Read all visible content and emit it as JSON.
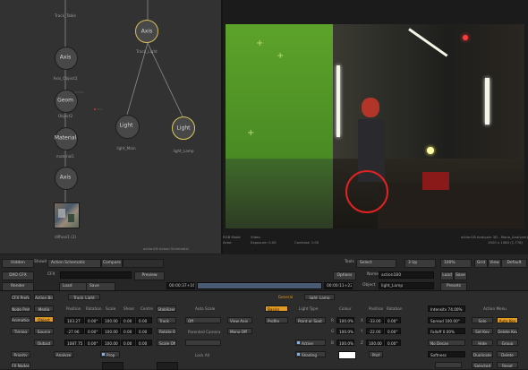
{
  "schematic": {
    "nodes": {
      "axis1": {
        "label": "Axis",
        "sublabel": "Axis_Object2"
      },
      "geom": {
        "label": "Geom",
        "sublabel": "Object2"
      },
      "material": {
        "label": "Material",
        "sublabel": "material1"
      },
      "axis2": {
        "label": "Axis"
      },
      "diffuse": {
        "sublabel": "diffuse1 (2)"
      },
      "axis_top": {
        "label": "Axis",
        "sublabel": "Track_Light"
      },
      "light_main": {
        "label": "Light",
        "sublabel": "light_Main"
      },
      "light_lamp": {
        "label": "Light",
        "sublabel": "light_Lamp"
      },
      "track_table": {
        "sublabel": "Track_Table"
      }
    },
    "footer": "action1B Action Schematic"
  },
  "viewer": {
    "info_left": [
      "RGB Mode",
      "Actor"
    ],
    "info_mid": [
      "Video",
      "Exposure: 0.00"
    ],
    "info_mid2": "Contrast: 1.00",
    "info_right": [
      "action1B Analyzer 3D - Mono_Analyzer)",
      "1920 x 1080 (1.778)"
    ]
  },
  "toolbar": {
    "hidden": "Hidden",
    "showing_label": "Showing",
    "showing_value": "Action Schematic",
    "compare": "Compare",
    "tools_label": "Tools",
    "tools_value": "Select",
    "view_value": "3 Up",
    "zoom": "100%",
    "grid": "Grid",
    "view": "View",
    "default": "Default",
    "dxo": "DXO CFX",
    "cfx": "CFX",
    "preview": "Preview",
    "options": "Options",
    "name_label": "Name",
    "name_value": "action1B0",
    "load_top": "Load",
    "save_top": "Save",
    "render": "Render",
    "load": "Load",
    "save": "Save",
    "tc_start": "00:00:37+16",
    "tc_end": "00:00:11+22",
    "object_label": "Object",
    "object_value": "light_Lamp",
    "presets": "Presets"
  },
  "panel": {
    "tabs": {
      "cfx_prefs": "CFX Prefs",
      "action_bin": "Action Bin",
      "track_light": "Track_Light",
      "general": "General",
      "light_lamp": "light_Lamp"
    },
    "left_buttons": [
      "Node Prefs",
      "Animation",
      "Timing",
      "Priority",
      "FX Nodes"
    ],
    "media": "Media",
    "object": "Object",
    "source": "Source",
    "output": "Output",
    "analyze": "Analyze",
    "headers": [
      "Position",
      "Rotation",
      "Scale",
      "Shear",
      "Centre",
      "Stabilizer"
    ],
    "rows": [
      {
        "pos": "103.27",
        "rot": "0.00°",
        "scale": "100.00",
        "shear": "0.00",
        "centre": "0.00"
      },
      {
        "pos": "-27.96",
        "rot": "0.00°",
        "scale": "100.00",
        "shear": "0.00",
        "centre": "0.00"
      },
      {
        "pos": "1087.75",
        "rot": "0.00°",
        "scale": "100.00",
        "shear": "0.00",
        "centre": "0.00"
      }
    ],
    "track": "Track",
    "rotate_off": "Rotate Off",
    "scale_off": "Scale Off",
    "prop": "Prop",
    "auto_scale": "Auto Scale",
    "off": "Off",
    "view_axis": "View Axis",
    "parented_camera": "Parented Camera",
    "mono_off": "Mono Off",
    "lock_all": "Lock All",
    "basics": "Basics",
    "profile": "Profile",
    "light_type_label": "Light Type",
    "light_type": "Point or Spot",
    "colour_label": "Colour",
    "active": "Active",
    "shading": "Shading",
    "rgb": [
      "R",
      "G",
      "B"
    ],
    "colour_vals": [
      "100.0%",
      "100.0%",
      "100.0%"
    ],
    "light_pos": [
      "-33.00",
      "-22.00",
      "100.00"
    ],
    "light_rot": [
      "0.00°",
      "0.00°",
      "0.00°"
    ],
    "intensity": "Intensity 74.00%",
    "spread": "Spread 100.00°",
    "falloff": "Falloff 0.00%",
    "no_decay": "No Decay",
    "softness": "Softness",
    "action_menu": "Action Menu",
    "solo": "Solo",
    "auto_key": "Auto Key",
    "set_key": "Set Key",
    "delete_key": "Delete Key",
    "hide": "Hide",
    "group": "Group",
    "duplicate": "Duplicate",
    "delete": "Delete",
    "selected": "Selected",
    "reset": "Reset"
  }
}
